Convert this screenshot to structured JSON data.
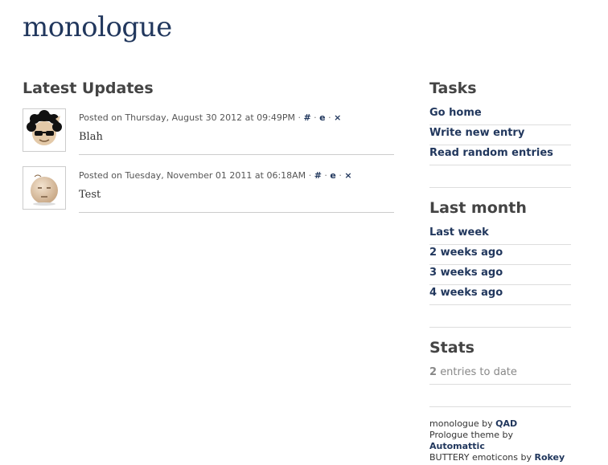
{
  "site": {
    "title": "monologue"
  },
  "main": {
    "heading": "Latest Updates",
    "posts": [
      {
        "meta_prefix": "Posted on Thursday, August 30 2012 at 09:49PM",
        "permalink": "#",
        "edit": "e",
        "delete": "×",
        "content": "Blah",
        "avatar_icon": "afro-sunglasses-emoticon-icon"
      },
      {
        "meta_prefix": "Posted on Tuesday, November 01 2011 at 06:18AM",
        "permalink": "#",
        "edit": "e",
        "delete": "×",
        "content": "Test",
        "avatar_icon": "bald-smiley-emoticon-icon"
      }
    ],
    "separator": "·"
  },
  "sidebar": {
    "tasks": {
      "heading": "Tasks",
      "items": [
        "Go home",
        "Write new entry",
        "Read random entries"
      ]
    },
    "last_month": {
      "heading": "Last month",
      "items": [
        "Last week",
        "2 weeks ago",
        "3 weeks ago",
        "4 weeks ago"
      ]
    },
    "stats": {
      "heading": "Stats",
      "count": "2",
      "suffix": "entries to date"
    },
    "credits": {
      "line1_prefix": "monologue by",
      "line1_link": "QAD",
      "line2_prefix": "Prologue theme by",
      "line2_link": "Automattic",
      "line3_prefix": "BUTTERY emoticons by",
      "line3_link": "Rokey"
    }
  },
  "colors": {
    "link": "#21375d",
    "heading": "#444444",
    "divider": "#dddddd"
  }
}
